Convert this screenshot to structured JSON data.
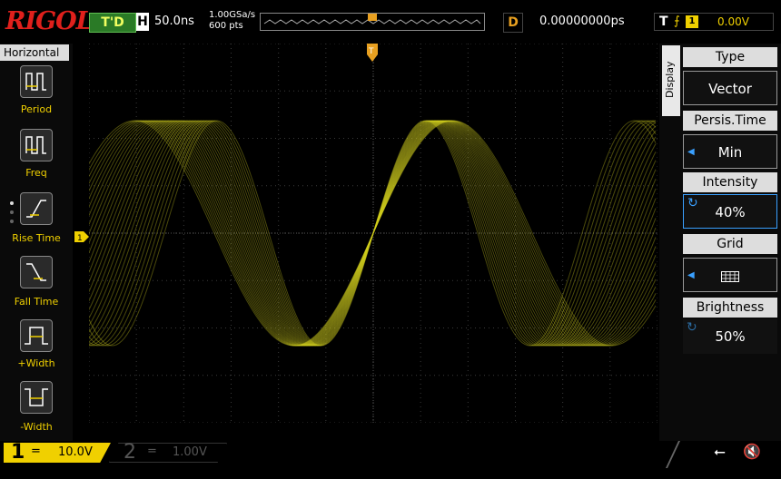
{
  "header": {
    "logo": "RIGOL",
    "run_status": "T'D",
    "timebase_label": "H",
    "timebase_value": "50.0ns",
    "sample_rate": "1.00GSa/s",
    "memory_depth": "600 pts",
    "delay_label": "D",
    "delay_value": "0.00000000ps",
    "trigger_label": "T",
    "trigger_source": "1",
    "trigger_level": "0.00V"
  },
  "left_menu": {
    "title": "Horizontal",
    "items": [
      {
        "label": "Period",
        "icon": "period-icon"
      },
      {
        "label": "Freq",
        "icon": "freq-icon"
      },
      {
        "label": "Rise Time",
        "icon": "rise-time-icon"
      },
      {
        "label": "Fall Time",
        "icon": "fall-time-icon"
      },
      {
        "label": "+Width",
        "icon": "positive-width-icon"
      },
      {
        "label": "-Width",
        "icon": "negative-width-icon"
      }
    ]
  },
  "right_menu": {
    "tab": "Display",
    "items": [
      {
        "title": "Type",
        "value": "Vector"
      },
      {
        "title": "Persis.Time",
        "value": "Min"
      },
      {
        "title": "Intensity",
        "value": "40%"
      },
      {
        "title": "Grid",
        "value": "",
        "icon": "grid-icon"
      },
      {
        "title": "Brightness",
        "value": "50%"
      }
    ]
  },
  "markers": {
    "channel1": "1",
    "trigger_position": "T",
    "trigger_level_marker": "T"
  },
  "channels": [
    {
      "number": "1",
      "coupling": "=",
      "scale": "10.0V",
      "enabled": true,
      "color": "#f0d000"
    },
    {
      "number": "2",
      "coupling": "=",
      "scale": "1.00V",
      "enabled": false,
      "color": "#555555"
    }
  ],
  "colors": {
    "waveform": "#d4d020",
    "accent": "#f0d000",
    "logo": "#e0201c",
    "status_bg": "#2a7a26"
  },
  "status_icons": [
    "usb-icon",
    "speaker-muted-icon"
  ]
}
